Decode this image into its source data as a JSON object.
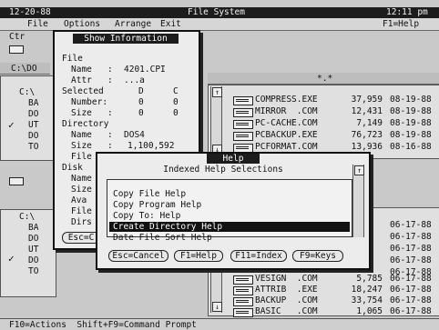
{
  "title_bar": {
    "date": "12-20-88",
    "title": "File System",
    "time": "12:11 pm"
  },
  "menu": {
    "items": [
      "File",
      "Options",
      "Arrange",
      "Exit"
    ],
    "help": "F1=Help"
  },
  "left_top": {
    "ctrl": "Ctr",
    "path": "C:\\DO",
    "tree": [
      "C:\\",
      "BA",
      "DO",
      "UT",
      "DO",
      "TO"
    ]
  },
  "left_bottom": {
    "tree": [
      "C:\\",
      "BA",
      "DO",
      "UT",
      "DO",
      "TO"
    ]
  },
  "right_top": {
    "header": "*.*",
    "files": [
      {
        "name": "COMPRESS.EXE",
        "size": "37,959",
        "date": "08-19-88"
      },
      {
        "name": "MIRROR  .COM",
        "size": "12,431",
        "date": "08-19-88"
      },
      {
        "name": "PC-CACHE.COM",
        "size": "7,149",
        "date": "08-19-88"
      },
      {
        "name": "PCBACKUP.EXE",
        "size": "76,723",
        "date": "08-19-88"
      },
      {
        "name": "PCFORMAT.COM",
        "size": "13,936",
        "date": "08-16-88"
      }
    ]
  },
  "right_bottom": {
    "dates_only": [
      "06-17-88",
      "06-17-88",
      "06-17-88",
      "06-17-88",
      "06-17-88",
      "06-17-88"
    ],
    "files": [
      {
        "name": "VESIGN  .COM",
        "size": "5,785",
        "date": "06-17-88"
      },
      {
        "name": "ATTRIB  .EXE",
        "size": "18,247",
        "date": "06-17-88"
      },
      {
        "name": "BACKUP  .COM",
        "size": "33,754",
        "date": "06-17-88"
      },
      {
        "name": "BASIC   .COM",
        "size": "1,065",
        "date": "06-17-88"
      }
    ]
  },
  "info_dialog": {
    "title": "Show Information",
    "file_label": "File",
    "name_label": "Name   :",
    "name_value": "4201.CPI",
    "attr_label": "Attr   :",
    "attr_value": "...a",
    "selected_label": "Selected",
    "col_d": "D",
    "col_c": "C",
    "number_label": "Number:",
    "number_d": "0",
    "number_c": "0",
    "size_label": "Size   :",
    "size_d": "0",
    "size_c": "0",
    "directory_label": "Directory",
    "dir_name_label": "Name   :",
    "dir_name_value": "DOS4",
    "dir_size_label": "Size   :",
    "dir_size_value": "1,100,592",
    "file_trunc": "File",
    "disk_label": "Disk",
    "disk_rows": [
      "Name",
      "Size",
      "Ava",
      "File",
      "Dirs"
    ],
    "esc_button": "Esc=C"
  },
  "help_dialog": {
    "title": "Help",
    "subtitle": "Indexed Help Selections",
    "items": [
      "Copy File Help",
      "Copy Program Help",
      "Copy To: Help",
      "Create Directory Help",
      "Date File Sort Help"
    ],
    "selected_index": 3,
    "buttons": [
      "Esc=Cancel",
      "F1=Help",
      "F11=Index",
      "F9=Keys"
    ]
  },
  "status_bar": {
    "text": "F10=Actions  Shift+F9=Command Prompt"
  }
}
